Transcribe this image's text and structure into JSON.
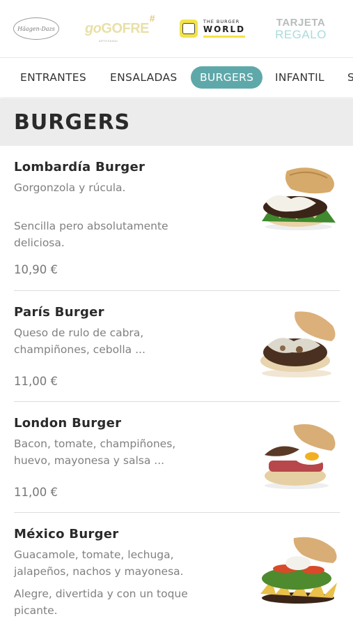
{
  "brands": {
    "haagen_dazs": "Häagen-Dazs",
    "gogofre": {
      "go": "go",
      "gofre": "GOFRE",
      "hash": "#",
      "sub": "ARTESANAL"
    },
    "burger_world": {
      "line1": "THE BURGER",
      "line2": "WORLD"
    },
    "tarjeta": {
      "line1": "TARJETA",
      "line2": "REGALO"
    }
  },
  "tabs": [
    {
      "label": "ENTRANTES",
      "active": false
    },
    {
      "label": "ENSALADAS",
      "active": false
    },
    {
      "label": "BURGERS",
      "active": true
    },
    {
      "label": "INFANTIL",
      "active": false
    },
    {
      "label": "S",
      "active": false
    }
  ],
  "section_title": "BURGERS",
  "items": [
    {
      "name": "Lombardía Burger",
      "desc1": "Gorgonzola y rúcula.",
      "desc2": "Sencilla pero absolutamente deliciosa.",
      "price": "10,90 €"
    },
    {
      "name": "París Burger",
      "desc1": "Queso de rulo de cabra, champiñones, cebolla ...",
      "price": "11,00 €"
    },
    {
      "name": "London Burger",
      "desc1": "Bacon, tomate, champiñones, huevo, mayonesa y salsa ...",
      "price": "11,00 €"
    },
    {
      "name": "México Burger",
      "desc1": "Guacamole, tomate, lechuga, jalapeños, nachos y mayonesa.",
      "desc2": "Alegre, divertida y con un toque picante."
    }
  ],
  "colors": {
    "accent": "#5fa8aa",
    "heading_bg": "#ececec",
    "divider": "#dcdcdc"
  }
}
